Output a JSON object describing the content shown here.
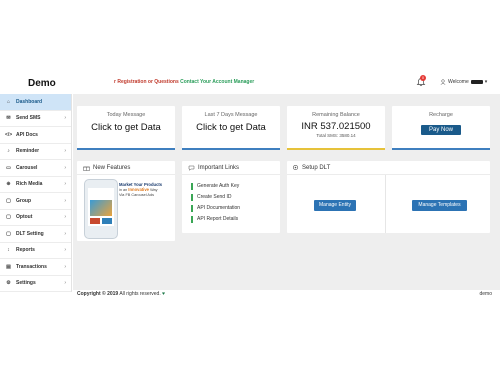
{
  "brand": "Demo",
  "marquee": {
    "part_a": "r Registration or Questions",
    "part_b": "Contact Your Account Manager"
  },
  "user": {
    "welcome": "Welcome",
    "notification_count": "0"
  },
  "sidebar": {
    "items": [
      {
        "label": "Dashboard",
        "icon": "home-icon",
        "glyph": "⌂",
        "active": true
      },
      {
        "label": "Send SMS",
        "icon": "send-icon",
        "glyph": "✉",
        "chevron": "›"
      },
      {
        "label": "API Docs",
        "icon": "code-icon",
        "glyph": "</>"
      },
      {
        "label": "Reminder",
        "icon": "bell-icon",
        "glyph": "♪",
        "chevron": "›"
      },
      {
        "label": "Carousel",
        "icon": "carousel-icon",
        "glyph": "▭",
        "chevron": "›"
      },
      {
        "label": "Rich Media",
        "icon": "rich-media-icon",
        "glyph": "⊕",
        "chevron": "›"
      },
      {
        "label": "Group",
        "icon": "group-icon",
        "glyph": "▢",
        "chevron": "›"
      },
      {
        "label": "Optout",
        "icon": "optout-icon",
        "glyph": "▢",
        "chevron": "›"
      },
      {
        "label": "DLT Setting",
        "icon": "dlt-icon",
        "glyph": "▢",
        "chevron": "›"
      },
      {
        "label": "Reports",
        "icon": "reports-icon",
        "glyph": "↕",
        "chevron": "›"
      },
      {
        "label": "Transactions",
        "icon": "transactions-icon",
        "glyph": "▤",
        "chevron": "›"
      },
      {
        "label": "Settings",
        "icon": "settings-icon",
        "glyph": "⚙",
        "chevron": "›"
      }
    ]
  },
  "stats": {
    "today": {
      "title": "Today Message",
      "value": "Click to get Data",
      "color": "#3f7fbf"
    },
    "last7": {
      "title": "Last 7 Days Message",
      "value": "Click to get Data",
      "color": "#3f7fbf"
    },
    "balance": {
      "title": "Remaining Balance",
      "value": "INR 537.021500",
      "sub": "Total SMS: 3580.14",
      "color": "#e6c23a"
    },
    "recharge": {
      "title": "Recharge",
      "button": "Pay Now",
      "color": "#3f7fbf"
    }
  },
  "new_features": {
    "title": "New Features",
    "promo_line1": "Market Your Products",
    "promo_line2a": "in an ",
    "promo_line2b": "Innovative",
    "promo_line2c": " Way",
    "promo_line3": "Via FB Carousel Ads"
  },
  "important_links": {
    "title": "Important Links",
    "links": [
      "Generate Auth Key",
      "Create Send ID",
      "API Documentation",
      "API Report Details"
    ]
  },
  "setup_dlt": {
    "title": "Setup DLT",
    "entity_button": "Manage Entity",
    "templates_button": "Manage Templates"
  },
  "footer": {
    "copyright": "Copyright © 2019",
    "rights": " All rights reserved.",
    "right_text": "demo"
  }
}
